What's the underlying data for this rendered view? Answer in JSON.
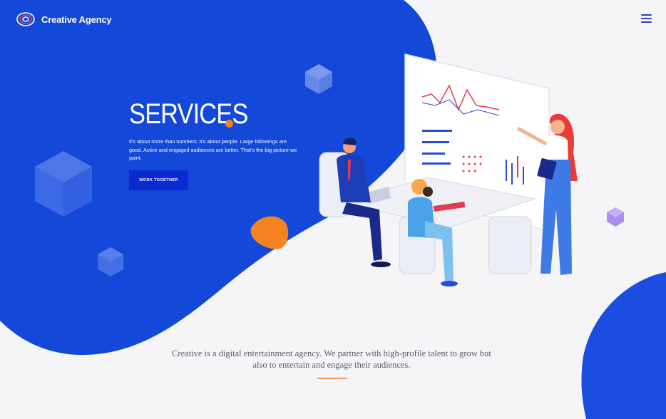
{
  "header": {
    "brand": "Creative Agency",
    "menu_icon": "hamburger-menu-icon"
  },
  "hero": {
    "title": "SERVICES",
    "description": "It's about more than numbers: it's about people. Large followings are good. Active and engaged audiences are better. That's the big picture we paint.",
    "cta_label": "WORK TOGETHER"
  },
  "intro": {
    "text": "Creative is a digital entertainment agency. We partner with high-profile talent to grow but also to entertain and engage their audiences."
  },
  "colors": {
    "primary_blue": "#1348d8",
    "button_blue": "#0b2ad0",
    "accent_orange": "#f58220",
    "background": "#f5f5f7"
  }
}
